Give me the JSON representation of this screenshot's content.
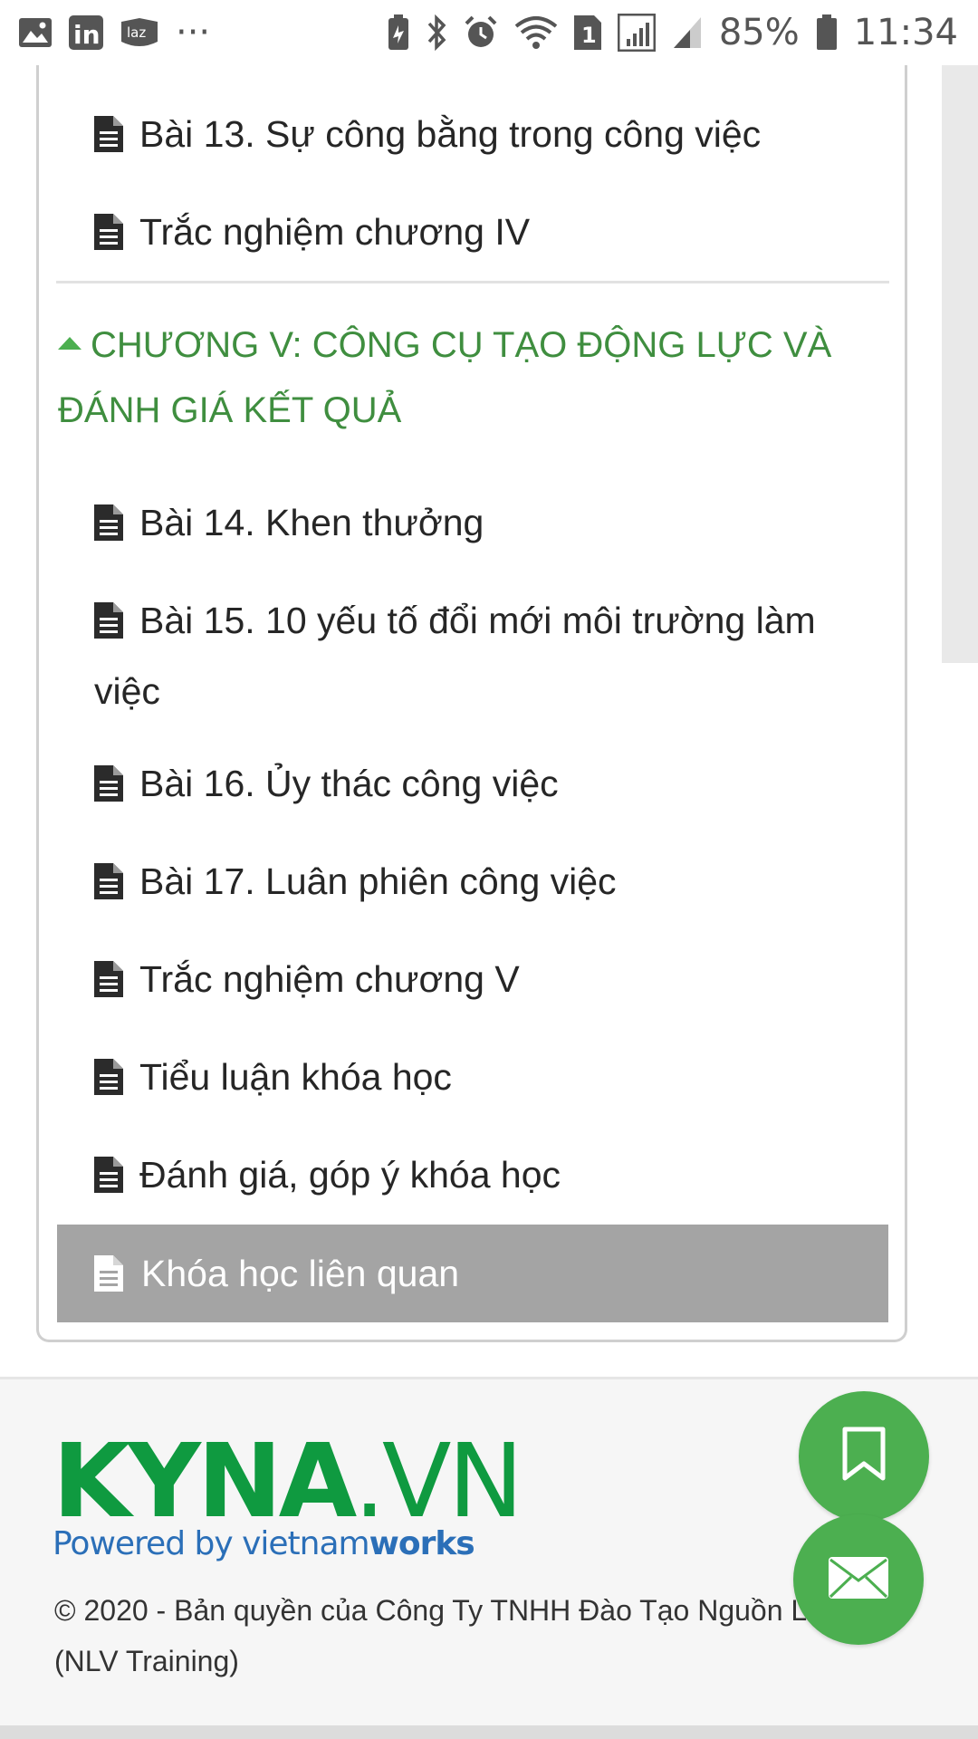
{
  "status_bar": {
    "battery_percent": "85%",
    "time": "11:34",
    "sim_slot": "1",
    "left_icons": [
      "gallery-icon",
      "linkedin-icon",
      "lazada-icon",
      "more-dots-icon"
    ],
    "right_icons": [
      "battery-saver-icon",
      "bluetooth-icon",
      "alarm-icon",
      "wifi-icon",
      "sim-1-icon",
      "signal-icon",
      "signal-icon",
      "battery-icon"
    ],
    "linkedin_text": "in",
    "lazada_text": "laz",
    "dots": "···"
  },
  "lessons_top": [
    {
      "label": "Bài 13. Sự công bằng trong công việc"
    },
    {
      "label": "Trắc nghiệm chương IV"
    }
  ],
  "chapter": {
    "title": "CHƯƠNG V: CÔNG CỤ TẠO ĐỘNG LỰC VÀ ĐÁNH GIÁ KẾT QUẢ"
  },
  "lessons": [
    {
      "label": "Bài 14. Khen thưởng"
    },
    {
      "label": "Bài 15. 10 yếu tố đổi mới môi trường làm việc"
    },
    {
      "label": "Bài 16. Ủy thác công việc"
    },
    {
      "label": "Bài 17. Luân phiên công việc"
    },
    {
      "label": "Trắc nghiệm chương V"
    },
    {
      "label": "Tiểu luận khóa học"
    },
    {
      "label": "Đánh giá, góp ý khóa học"
    }
  ],
  "related": {
    "label": "Khóa học liên quan"
  },
  "footer": {
    "logo_main": "KYNA",
    "logo_suffix": ".VN",
    "logo_powered": "Powered by vietnam",
    "logo_works": "works",
    "copyright": "© 2020 - Bản quyền của Công Ty TNHH Đào Tạo Nguồn L (NLV Training)"
  },
  "colors": {
    "accent_green": "#4caf50",
    "chapter_green": "#3f8e3f",
    "logo_green": "#0f9a40",
    "logo_blue": "#2b6fb8",
    "related_bg": "#a4a4a4"
  }
}
